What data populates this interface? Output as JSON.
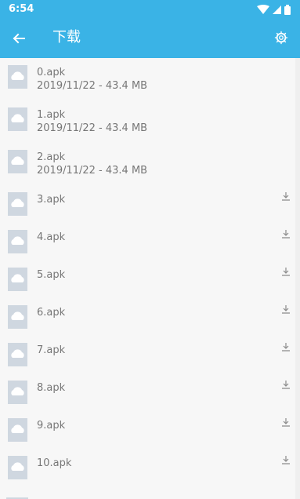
{
  "status_bar": {
    "time": "6:54",
    "icons": [
      "wifi-icon",
      "cellular-signal-icon",
      "battery-icon"
    ]
  },
  "app_bar": {
    "title": "下载",
    "back_icon": "arrow-left-icon",
    "settings_icon": "gear-icon",
    "color": "#3ab3e6"
  },
  "files": [
    {
      "name": "0.apk",
      "meta": "2019/11/22 - 43.4 MB",
      "downloaded": true
    },
    {
      "name": "1.apk",
      "meta": "2019/11/22 - 43.4 MB",
      "downloaded": true
    },
    {
      "name": "2.apk",
      "meta": "2019/11/22 - 43.4 MB",
      "downloaded": true
    },
    {
      "name": "3.apk",
      "downloaded": false
    },
    {
      "name": "4.apk",
      "downloaded": false
    },
    {
      "name": "5.apk",
      "downloaded": false
    },
    {
      "name": "6.apk",
      "downloaded": false
    },
    {
      "name": "7.apk",
      "downloaded": false
    },
    {
      "name": "8.apk",
      "downloaded": false
    },
    {
      "name": "9.apk",
      "downloaded": false
    },
    {
      "name": "10.apk",
      "downloaded": false
    }
  ],
  "colors": {
    "text": "#777777",
    "file_icon": "#cfd7e0",
    "download_icon": "#8a8a8a"
  }
}
